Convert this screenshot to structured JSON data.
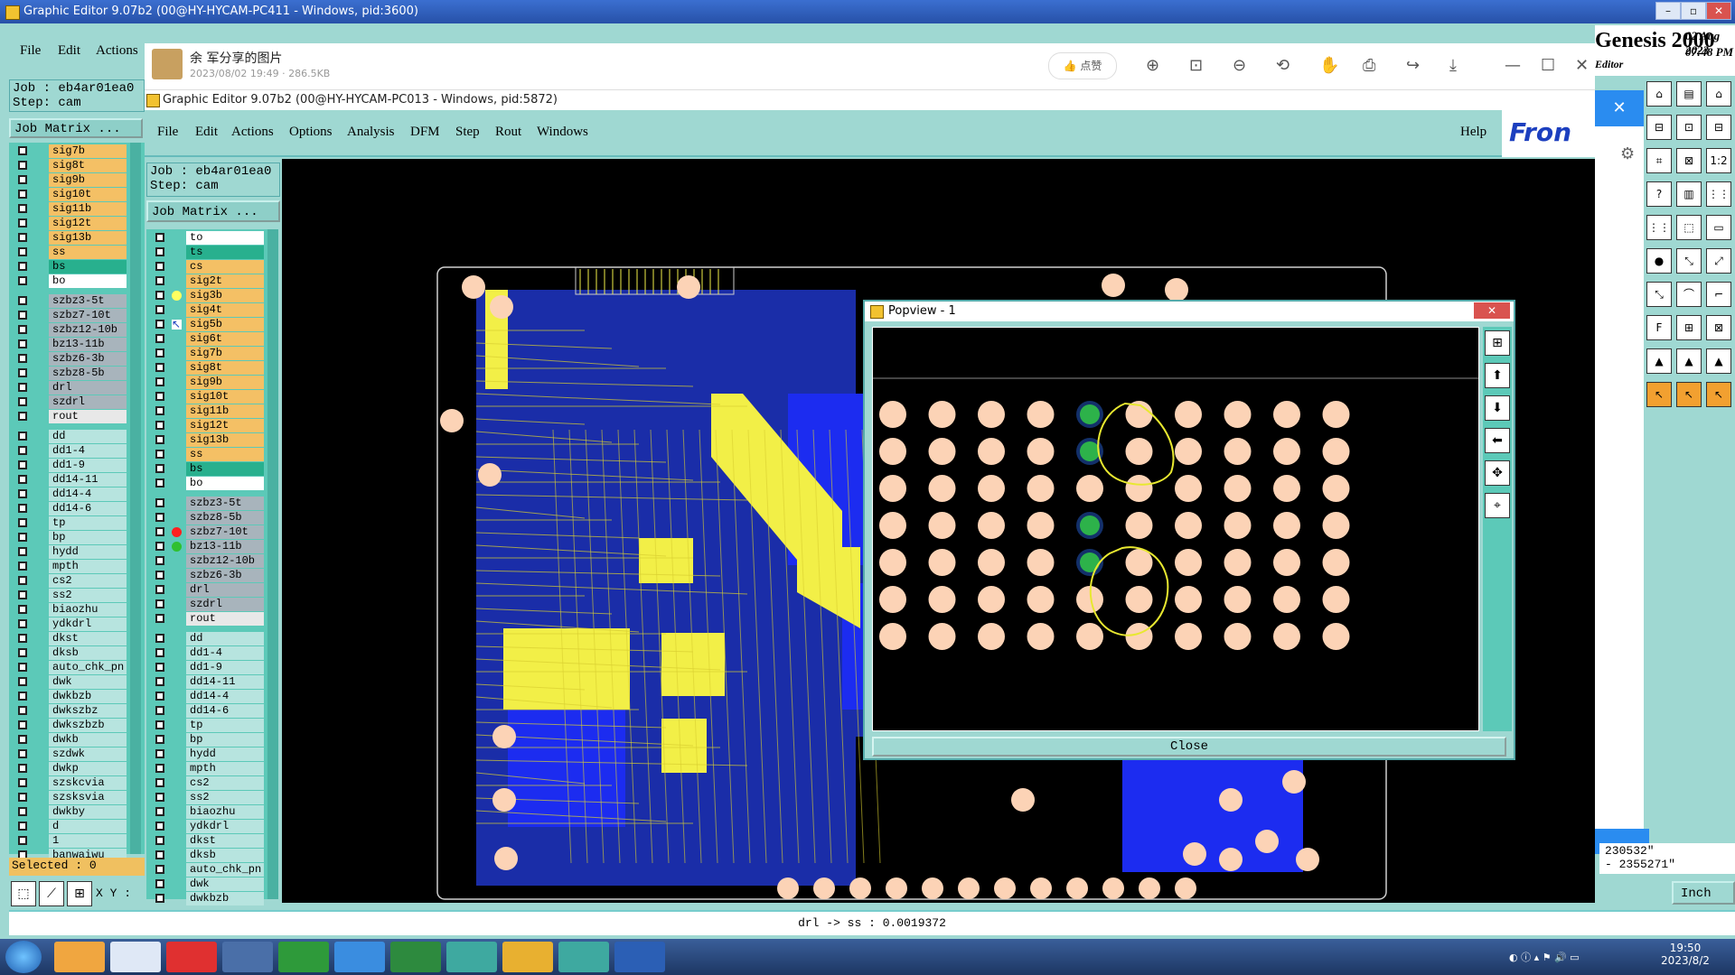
{
  "back_window": {
    "title": "Graphic Editor 9.07b2 (00@HY-HYCAM-PC411 - Windows, pid:3600)",
    "menu": [
      "File",
      "Edit",
      "Actions"
    ],
    "job_label": "Job : eb4ar01ea0",
    "step_label": "Step: cam",
    "job_matrix": "Job Matrix ...",
    "selected": "Selected : 0",
    "xy_label": "X Y :",
    "layers_top": [
      {
        "name": "sig7b",
        "color": "#f4c065"
      },
      {
        "name": "sig8t",
        "color": "#f4c065"
      },
      {
        "name": "sig9b",
        "color": "#f4c065"
      },
      {
        "name": "sig10t",
        "color": "#f4c065"
      },
      {
        "name": "sig11b",
        "color": "#f4c065"
      },
      {
        "name": "sig12t",
        "color": "#f4c065"
      },
      {
        "name": "sig13b",
        "color": "#f4c065"
      },
      {
        "name": "ss",
        "color": "#f4c065"
      },
      {
        "name": "bs",
        "color": "#28b08e"
      },
      {
        "name": "bo",
        "color": "#ffffff"
      }
    ],
    "layers_mid": [
      {
        "name": "szbz3-5t",
        "color": "#a8b4bc"
      },
      {
        "name": "szbz7-10t",
        "color": "#a8b4bc"
      },
      {
        "name": "szbz12-10b",
        "color": "#a8b4bc"
      },
      {
        "name": "bz13-11b",
        "color": "#a8b4bc"
      },
      {
        "name": "szbz6-3b",
        "color": "#a8b4bc"
      },
      {
        "name": "szbz8-5b",
        "color": "#a8b4bc"
      },
      {
        "name": "drl",
        "color": "#a8b4bc"
      },
      {
        "name": "szdrl",
        "color": "#a8b4bc"
      },
      {
        "name": "rout",
        "color": "#e8e8e8"
      }
    ],
    "layers_bottom": [
      "dd",
      "dd1-4",
      "dd1-9",
      "dd14-11",
      "dd14-4",
      "dd14-6",
      "tp",
      "bp",
      "hydd",
      "mpth",
      "cs2",
      "ss2",
      "biaozhu",
      "ydkdrl",
      "dkst",
      "dksb",
      "auto_chk_pn",
      "dwk",
      "dwkbzb",
      "dwkszbz",
      "dwkszbzb",
      "dwkb",
      "szdwk",
      "dwkp",
      "szskcvia",
      "szsksvia",
      "dwkby",
      "d",
      "1",
      "banwaiwu"
    ],
    "brand": "Genesis 2000",
    "date": "02 Aug 2023",
    "time": "07:48 PM",
    "editor_label": "Editor",
    "coord1": "230532\"",
    "coord2": "- 2355271\"",
    "units": "Inch",
    "status_text": "drl -> ss : 0.0019372"
  },
  "photo_viewer": {
    "author": "余 军分享的图片",
    "meta": "2023/08/02 19:49 · 286.5KB",
    "like_label": "点赞",
    "icons": [
      "zoom-in-icon",
      "fit-icon",
      "zoom-out-icon",
      "rotate-icon",
      "hand-icon",
      "print-icon",
      "share-icon",
      "download-icon"
    ]
  },
  "front_window": {
    "title": "Graphic Editor 9.07b2 (00@HY-HYCAM-PC013 - Windows, pid:5872)",
    "menu": [
      "File",
      "Edit",
      "Actions",
      "Options",
      "Analysis",
      "DFM",
      "Step",
      "Rout",
      "Windows"
    ],
    "help": "Help",
    "brand": "Fron",
    "job_label": "Job : eb4ar01ea0",
    "step_label": "Step: cam",
    "job_matrix": "Job Matrix ...",
    "layers_top": [
      {
        "name": "to",
        "color": "#ffffff"
      },
      {
        "name": "ts",
        "color": "#28b08e"
      },
      {
        "name": "cs",
        "color": "#f4c065"
      },
      {
        "name": "sig2t",
        "color": "#f4c065"
      },
      {
        "name": "sig3b",
        "color": "#f4c065",
        "marker": "#ffff60"
      },
      {
        "name": "sig4t",
        "color": "#f4c065"
      },
      {
        "name": "sig5b",
        "color": "#f4c065",
        "marker": "arrow"
      },
      {
        "name": "sig6t",
        "color": "#f4c065"
      },
      {
        "name": "sig7b",
        "color": "#f4c065"
      },
      {
        "name": "sig8t",
        "color": "#f4c065"
      },
      {
        "name": "sig9b",
        "color": "#f4c065"
      },
      {
        "name": "sig10t",
        "color": "#f4c065"
      },
      {
        "name": "sig11b",
        "color": "#f4c065"
      },
      {
        "name": "sig12t",
        "color": "#f4c065"
      },
      {
        "name": "sig13b",
        "color": "#f4c065"
      },
      {
        "name": "ss",
        "color": "#f4c065"
      },
      {
        "name": "bs",
        "color": "#28b08e"
      },
      {
        "name": "bo",
        "color": "#ffffff"
      }
    ],
    "layers_mid": [
      {
        "name": "szbz3-5t",
        "color": "#a8b4bc"
      },
      {
        "name": "szbz8-5b",
        "color": "#a8b4bc"
      },
      {
        "name": "szbz7-10t",
        "color": "#a8b4bc",
        "marker": "#ff2020"
      },
      {
        "name": "bz13-11b",
        "color": "#a8b4bc",
        "marker": "#30c030"
      },
      {
        "name": "szbz12-10b",
        "color": "#a8b4bc"
      },
      {
        "name": "szbz6-3b",
        "color": "#a8b4bc"
      },
      {
        "name": "drl",
        "color": "#a8b4bc"
      },
      {
        "name": "szdrl",
        "color": "#a8b4bc"
      },
      {
        "name": "rout",
        "color": "#e8e8e8"
      }
    ],
    "layers_bottom": [
      "dd",
      "dd1-4",
      "dd1-9",
      "dd14-11",
      "dd14-4",
      "dd14-6",
      "tp",
      "bp",
      "hydd",
      "mpth",
      "cs2",
      "ss2",
      "biaozhu",
      "ydkdrl",
      "dkst",
      "dksb",
      "auto_chk_pn",
      "dwk",
      "dwkbzb"
    ]
  },
  "popview": {
    "title": "Popview - 1",
    "close_label": "Close",
    "grid": {
      "cols": 10,
      "rows": 7,
      "green": [
        [
          4,
          0
        ],
        [
          4,
          1
        ],
        [
          4,
          3
        ],
        [
          4,
          4
        ]
      ]
    }
  },
  "taskbar": {
    "time": "19:50",
    "date": "2023/8/2"
  },
  "colors": {
    "pcb_yellow": "#f2ef47",
    "pcb_blue": "#1c2cf0",
    "pcb_navy": "#1a2da8",
    "pad": "#fcd3b6",
    "pad_green": "#2db24a",
    "panel": "#9fd8d2"
  }
}
